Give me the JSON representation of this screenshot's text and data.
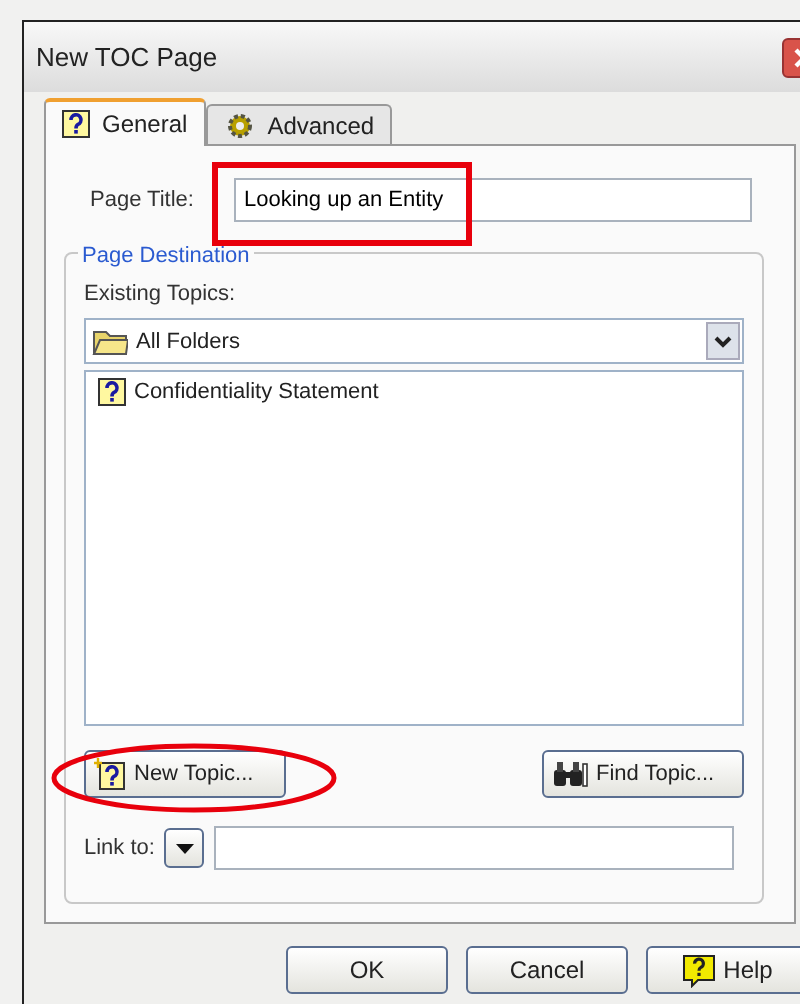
{
  "window": {
    "title": "New TOC Page"
  },
  "tabs": [
    {
      "label": "General",
      "selected": true,
      "kind": "help"
    },
    {
      "label": "Advanced",
      "selected": false,
      "kind": "gear"
    }
  ],
  "page_title": {
    "label": "Page Title:",
    "value": "Looking up an Entity"
  },
  "page_destination": {
    "title": "Page Destination",
    "existing_topics_label": "Existing Topics:",
    "folder": "All Folders",
    "topics": [
      {
        "label": "Confidentiality Statement"
      }
    ],
    "new_topic_button": "New Topic...",
    "find_topic_button": "Find Topic...",
    "link_to_label": "Link to:"
  },
  "buttons": [
    {
      "label": "OK",
      "kind": "plain"
    },
    {
      "label": "Cancel",
      "kind": "plain"
    },
    {
      "label": "Help",
      "kind": "help"
    }
  ]
}
